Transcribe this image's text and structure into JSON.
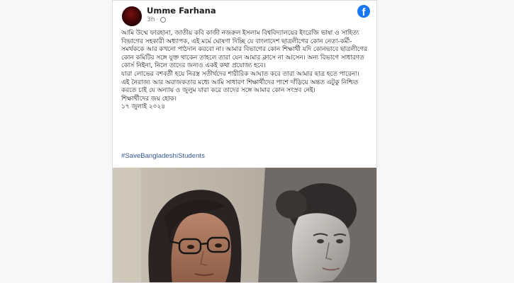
{
  "post": {
    "author": "Umme Farhana",
    "time": "3h",
    "separator": "·",
    "paragraphs": [
      "আমি উম্মে ফারহানা, জাতীয় কবি কাজী নজরুল ইসলাম বিশ্ববিদ্যালয়ের ইংরেজি ভাষা ও সাহিত্য বিভাগের সহকারী অধ্যাপক, এই মর্মে ঘোষণা দিচ্ছি যে বাংলাদেশ ছাত্রলীগের কোন নেতা-কর্মী-সমর্থককে আর কখনো পাঠদান করবো না। আমার বিভাগের কোন শিক্ষার্থী যদি কোনভাবে ছাত্রলীগের কোন কমিটির সঙ্গে যুক্ত থাকেন তাহলে তারা যেন আমার ক্লাসে না আসেন। অন্য বিভাগে সাধারণত কোর্স নিইনা, নিলে তাদের জন্যও একই কথা প্রযোজ্য হবে।",
      "যারা লোভের বশবর্তী হয়ে নিরস্ত্র সতীর্থদের শারীরিক আঘাত করে তারা আমার ছাত্র হতে পারেনা।",
      "এই নৈরাজ্য আর অরাজকতার মধ্যে আমি সাধারণ শিক্ষার্থীদের পাশে দাঁড়িয়ে অন্তত এটুকু নিশ্চিত করতে চাই যে অন্যায় ও জুলুম যারা করে তাদের সঙ্গে আমার কোন সংস্রব নেই।",
      "শিক্ষার্থীদের জয় হোক।",
      "১৭ জুলাই ২০২৪"
    ],
    "hashtag": "#SaveBangladeshiStudents"
  },
  "icons": [
    "avatar",
    "globe-icon",
    "facebook-icon"
  ],
  "colors": {
    "facebook_blue": "#1877f2",
    "link": "#385898",
    "text": "#1c1e21",
    "meta": "#7a7d82"
  }
}
